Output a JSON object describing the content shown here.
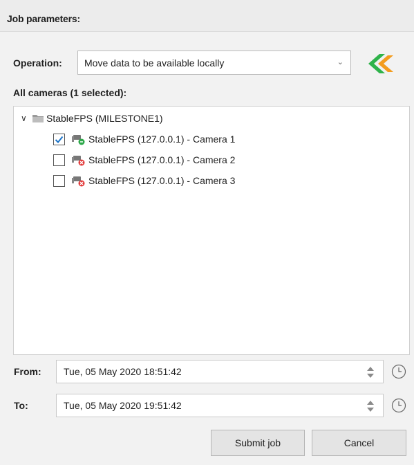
{
  "header": {
    "title": "Job parameters:"
  },
  "operation": {
    "label": "Operation:",
    "value": "Move data to be available locally"
  },
  "cameras": {
    "label": "All cameras (1 selected):",
    "root": "StableFPS (MILESTONE1)",
    "items": [
      {
        "label": "StableFPS (127.0.0.1) - Camera 1",
        "checked": true,
        "status": "online-green"
      },
      {
        "label": "StableFPS (127.0.0.1) - Camera 2",
        "checked": false,
        "status": "error-red"
      },
      {
        "label": "StableFPS (127.0.0.1) - Camera 3",
        "checked": false,
        "status": "error-red"
      }
    ]
  },
  "from": {
    "label": "From:",
    "value": "Tue, 05 May 2020 18:51:42"
  },
  "to": {
    "label": "To:",
    "value": "Tue, 05 May 2020 19:51:42"
  },
  "buttons": {
    "submit": "Submit job",
    "cancel": "Cancel"
  },
  "colors": {
    "check": "#1a73c8",
    "logo_green": "#2fb34a",
    "logo_orange": "#f39c1e",
    "status_green": "#2ea84a",
    "status_red": "#e23a3a"
  }
}
